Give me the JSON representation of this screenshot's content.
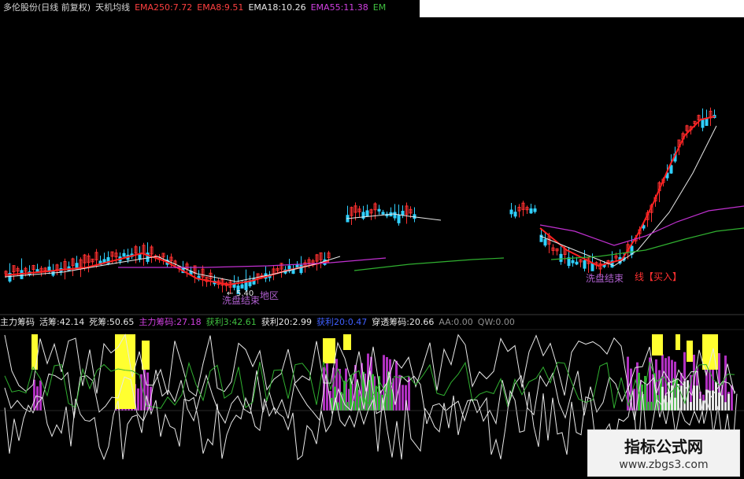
{
  "header": {
    "items": [
      {
        "text": "多伦股份(日线 前复权)",
        "color": "#d8d8d8"
      },
      {
        "text": "天机均线",
        "color": "#d8d8d8"
      },
      {
        "text": "EMA250:7.72",
        "color": "#ff4040"
      },
      {
        "text": "EMA8:9.51",
        "color": "#ff4040"
      },
      {
        "text": "EMA18:10.26",
        "color": "#e8e8e8"
      },
      {
        "text": "EMA55:11.38",
        "color": "#d040e0"
      },
      {
        "text": "EM",
        "color": "#40c040"
      }
    ]
  },
  "indicator_header": {
    "items": [
      {
        "text": "主力筹码",
        "color": "#e8e8e8"
      },
      {
        "text": "活筹:42.14",
        "color": "#e8e8e8"
      },
      {
        "text": "死筹:50.65",
        "color": "#e8e8e8"
      },
      {
        "text": "主力筹码:27.18",
        "color": "#d040e0"
      },
      {
        "text": "获利3:42.61",
        "color": "#40c040"
      },
      {
        "text": "获利20:2.99",
        "color": "#e8e8e8"
      },
      {
        "text": "获利20:0.47",
        "color": "#4060ff"
      },
      {
        "text": "穿透筹码:20.66",
        "color": "#e8e8e8"
      },
      {
        "text": "AA:0.00",
        "color": "#909090"
      },
      {
        "text": "QW:0.00",
        "color": "#909090"
      }
    ]
  },
  "annotations": {
    "price_low": "5.40",
    "label_left": "洗盘结束",
    "label_left_tail": "地区",
    "label_right": "洗盘结束",
    "buy_label": "线【买入】"
  },
  "watermark": {
    "title": "指标公式网",
    "url": "www.zbgs3.com"
  },
  "colors": {
    "background": "#000000",
    "up": "#ff3030",
    "down": "#30d0ff",
    "ema8": "#ff2020",
    "ema18": "#e8e8e8",
    "ema55": "#c030d0",
    "ema250": "#30b030",
    "yellow": "#ffff30",
    "purple": "#b030c0",
    "green": "#30b030",
    "white": "#e8e8e8"
  }
}
